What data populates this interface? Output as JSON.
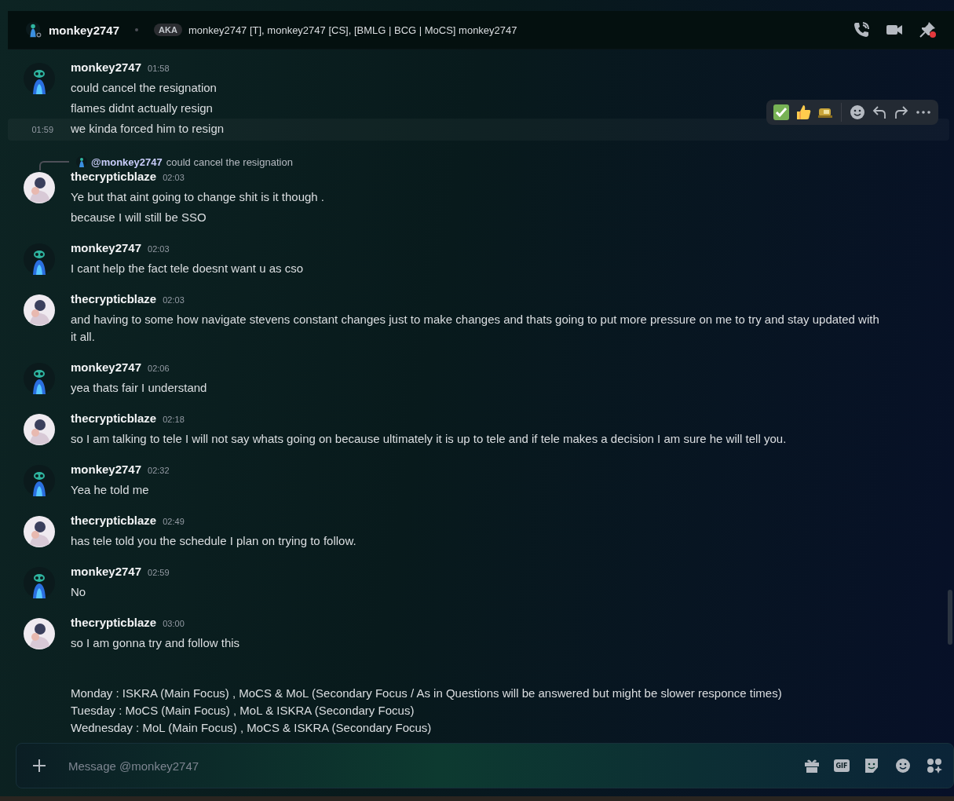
{
  "header": {
    "name": "monkey2747",
    "aka_badge": "AKA",
    "aka_names": "monkey2747 [T], monkey2747 [CS], [BMLG | BCG | MoCS] monkey2747"
  },
  "messages": [
    {
      "author": "monkey2747",
      "kind": "monkey",
      "time": "01:58",
      "lines": [
        {
          "text": "could cancel the resignation",
          "hovered": false
        },
        {
          "text": "flames didnt actually resign",
          "hovered": false
        },
        {
          "text": "we kinda forced him to resign",
          "time": "01:59",
          "hovered": true
        }
      ]
    },
    {
      "author": "thecrypticblaze",
      "kind": "blaze",
      "time": "02:03",
      "reply": {
        "mention": "@monkey2747",
        "text": "could cancel the resignation"
      },
      "lines": [
        {
          "text": "Ye but that aint going to change shit is it though .",
          "hovered": false
        },
        {
          "text": "because I will still be SSO",
          "hovered": false
        }
      ]
    },
    {
      "author": "monkey2747",
      "kind": "monkey",
      "time": "02:03",
      "lines": [
        {
          "text": "I cant help the fact tele doesnt want u as cso",
          "hovered": false
        }
      ]
    },
    {
      "author": "thecrypticblaze",
      "kind": "blaze",
      "time": "02:03",
      "lines": [
        {
          "text": "and having to some how navigate stevens constant changes just to make changes and thats going to put more pressure on me to try and stay updated with it all.",
          "hovered": false
        }
      ]
    },
    {
      "author": "monkey2747",
      "kind": "monkey",
      "time": "02:06",
      "lines": [
        {
          "text": "yea thats fair I understand",
          "hovered": false
        }
      ]
    },
    {
      "author": "thecrypticblaze",
      "kind": "blaze",
      "time": "02:18",
      "lines": [
        {
          "text": "so I am talking to tele I will not say whats going on because ultimately it is up to tele and if tele makes a decision I am sure he will tell you.",
          "hovered": false
        }
      ]
    },
    {
      "author": "monkey2747",
      "kind": "monkey",
      "time": "02:32",
      "lines": [
        {
          "text": "Yea he told me",
          "hovered": false
        }
      ]
    },
    {
      "author": "thecrypticblaze",
      "kind": "blaze",
      "time": "02:49",
      "lines": [
        {
          "text": "has tele told you the schedule I plan on trying to follow.",
          "hovered": false
        }
      ]
    },
    {
      "author": "monkey2747",
      "kind": "monkey",
      "time": "02:59",
      "lines": [
        {
          "text": "No",
          "hovered": false
        }
      ]
    },
    {
      "author": "thecrypticblaze",
      "kind": "blaze",
      "time": "03:00",
      "lines": [
        {
          "text": "so I am gonna try and follow this",
          "hovered": false
        }
      ],
      "schedule": [
        "Monday : ISKRA (Main Focus) , MoCS & MoL (Secondary Focus / As in Questions will be answered but might be slower responce times)",
        "Tuesday : MoCS (Main Focus) , MoL & ISKRA (Secondary Focus)",
        "Wednesday : MoL (Main Focus) , MoCS & ISKRA (Secondary Focus)"
      ]
    }
  ],
  "composer": {
    "placeholder": "Message @monkey2747",
    "gif_label": "GIF"
  }
}
